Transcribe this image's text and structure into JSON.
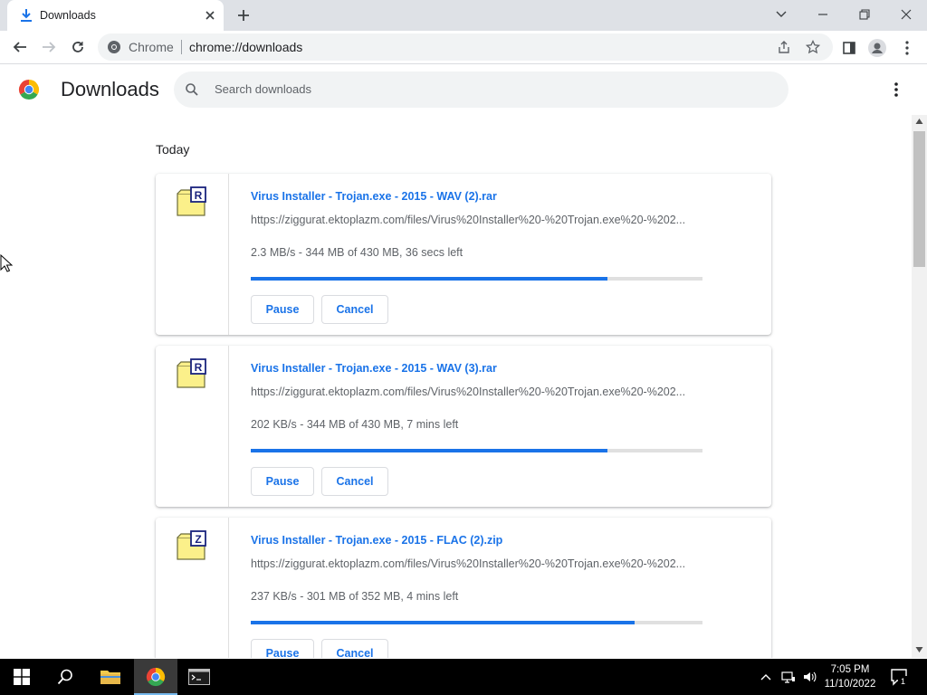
{
  "tab": {
    "title": "Downloads",
    "icon": "download-icon"
  },
  "window_controls": [
    "chevron-down-icon",
    "minimize-icon",
    "restore-icon",
    "close-icon"
  ],
  "omnibox": {
    "site_label": "Chrome",
    "url": "chrome://downloads"
  },
  "page": {
    "title": "Downloads",
    "search_placeholder": "Search downloads",
    "section_label": "Today"
  },
  "downloads": [
    {
      "file_name": "Virus Installer - Trojan.exe - 2015 - WAV (2).rar",
      "url": "https://ziggurat.ektoplazm.com/files/Virus%20Installer%20-%20Trojan.exe%20-%202...",
      "status": "2.3 MB/s - 344 MB of 430 MB, 36 secs left",
      "progress": 0.79,
      "icon_letter": "R",
      "pause_label": "Pause",
      "cancel_label": "Cancel"
    },
    {
      "file_name": "Virus Installer - Trojan.exe - 2015 - WAV (3).rar",
      "url": "https://ziggurat.ektoplazm.com/files/Virus%20Installer%20-%20Trojan.exe%20-%202...",
      "status": "202 KB/s - 344 MB of 430 MB, 7 mins left",
      "progress": 0.79,
      "icon_letter": "R",
      "pause_label": "Pause",
      "cancel_label": "Cancel"
    },
    {
      "file_name": "Virus Installer - Trojan.exe - 2015 - FLAC (2).zip",
      "url": "https://ziggurat.ektoplazm.com/files/Virus%20Installer%20-%20Trojan.exe%20-%202...",
      "status": "237 KB/s - 301 MB of 352 MB, 4 mins left",
      "progress": 0.85,
      "icon_letter": "Z",
      "pause_label": "Pause",
      "cancel_label": "Cancel"
    }
  ],
  "taskbar": {
    "time": "7:05 PM",
    "date": "11/10/2022",
    "notification_count": "1"
  },
  "colors": {
    "accent": "#1a73e8",
    "tabstrip": "#dee1e6",
    "taskbar": "#000000"
  }
}
